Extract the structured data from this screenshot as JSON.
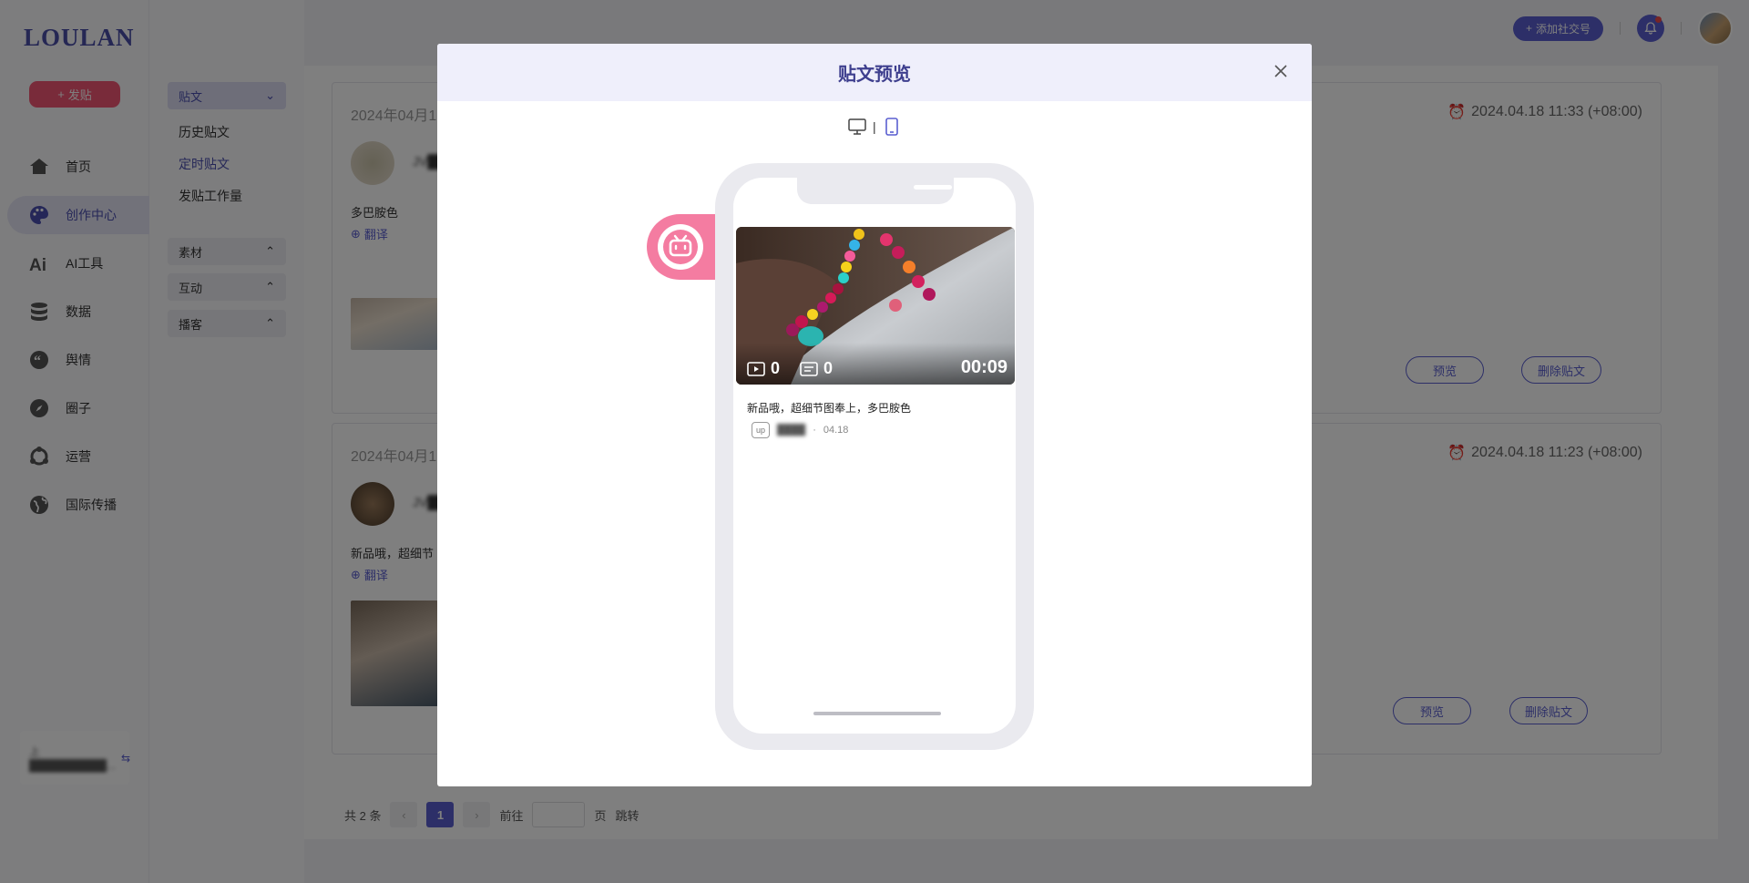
{
  "app": {
    "logo": "LOULAN",
    "post_button": "发贴"
  },
  "nav": {
    "items": [
      {
        "label": "首页",
        "icon": "home-icon"
      },
      {
        "label": "创作中心",
        "icon": "palette-icon",
        "active": true
      },
      {
        "label": "AI工具",
        "icon": "ai-icon"
      },
      {
        "label": "数据",
        "icon": "database-icon"
      },
      {
        "label": "舆情",
        "icon": "quote-icon"
      },
      {
        "label": "圈子",
        "icon": "compass-icon"
      },
      {
        "label": "运营",
        "icon": "operations-icon"
      },
      {
        "label": "国际传播",
        "icon": "globe-icon"
      }
    ],
    "account_name": "上██████████..."
  },
  "subnav": {
    "posts_group": "贴文",
    "links": [
      "历史贴文",
      "定时贴文",
      "发贴工作量"
    ],
    "groups": [
      "素材",
      "互动",
      "播客"
    ]
  },
  "topbar": {
    "add_social": "添加社交号"
  },
  "posts": [
    {
      "date": "2024年04月1",
      "schedule": "2024.04.18 11:33 (+08:00)",
      "name": "JV██",
      "text": "多巴胺色",
      "translate": "翻译",
      "preview": "预览",
      "delete": "删除贴文"
    },
    {
      "date": "2024年04月1",
      "schedule": "2024.04.18 11:23 (+08:00)",
      "name": "JV██",
      "text": "新品哦，超细节",
      "translate": "翻译",
      "preview": "预览",
      "delete": "删除贴文"
    }
  ],
  "pagination": {
    "total": "共 2 条",
    "current": "1",
    "goto_label": "前往",
    "page_unit": "页",
    "jump": "跳转"
  },
  "modal": {
    "title": "贴文预览",
    "toggle_sep": "|",
    "preview": {
      "platform_icon": "bilibili-icon",
      "plays": "0",
      "comments": "0",
      "duration": "00:09",
      "caption": "新品哦，超细节图奉上，多巴胺色",
      "up_badge": "up",
      "author": "████",
      "date_sep": "·",
      "date": "04.18"
    }
  },
  "colors": {
    "accent": "#5a5fd0",
    "post_button": "#f25675",
    "bilibili_pink": "#f47ca1"
  }
}
